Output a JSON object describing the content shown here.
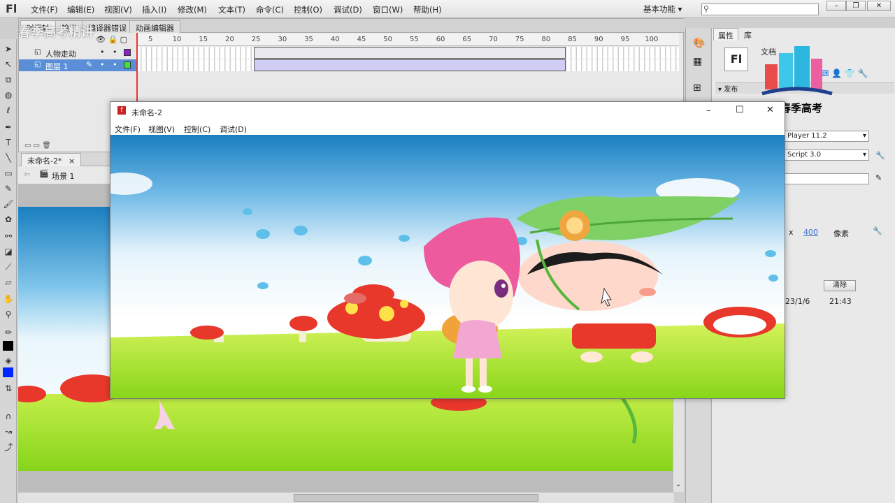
{
  "menubar": {
    "app_logo": "Fl",
    "items": [
      "文件(F)",
      "编辑(E)",
      "视图(V)",
      "插入(I)",
      "修改(M)",
      "文本(T)",
      "命令(C)",
      "控制(O)",
      "调试(D)",
      "窗口(W)",
      "帮助(H)"
    ],
    "workspace": "基本功能"
  },
  "watermark": {
    "top_left": "春季高考精讲",
    "logo_caption": "山东春季高考"
  },
  "timeline": {
    "tabs": [
      "时间轴",
      "输出",
      "编译器错误",
      "动画编辑器"
    ],
    "ticks": [
      "5",
      "10",
      "15",
      "20",
      "25",
      "30",
      "35",
      "40",
      "45",
      "50",
      "55",
      "60",
      "65",
      "70",
      "75",
      "80",
      "85",
      "90",
      "95",
      "100"
    ],
    "layers": [
      "人物走动",
      "图层 1"
    ]
  },
  "document": {
    "tab_label": "未命名-2*",
    "scene_label": "场景 1"
  },
  "properties": {
    "tabs": [
      "属性",
      "库"
    ],
    "doc_label": "文档",
    "publish_section": "发布",
    "player_value": "Player 11.2",
    "script_value": "Script 3.0",
    "size_x": "x",
    "size_value": "400",
    "size_unit": "像素",
    "clear_button": "清除",
    "date": "23/1/6",
    "time": "21:43"
  },
  "player": {
    "title": "未命名-2",
    "menu": [
      "文件(F)",
      "视图(V)",
      "控制(C)",
      "调试(D)"
    ]
  },
  "colors": {
    "accent_blue": "#5a8fd8",
    "frame_span": "#cfcdf4",
    "sky_top": "#1a7fc0",
    "grass": "#8fd81c"
  }
}
